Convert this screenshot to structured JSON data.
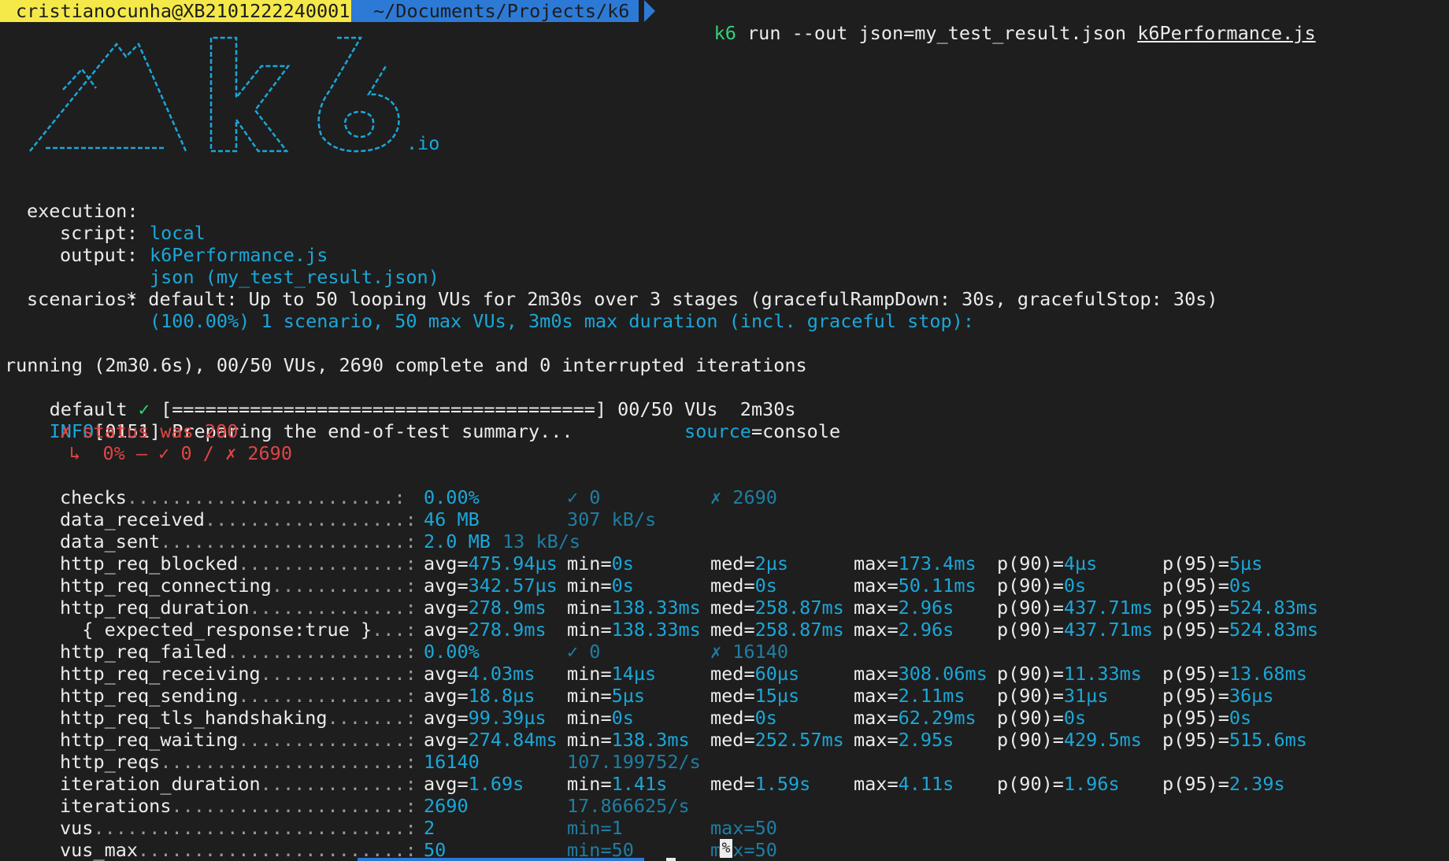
{
  "prompt": {
    "user": "cristianocunha@XB2101222240001",
    "path": "~/Documents/Projects/k6",
    "command": "k6",
    "args": " run --out json=my_test_result.json ",
    "script_file": "k6Performance.js"
  },
  "logo": {
    "suffix": ".io"
  },
  "execution": {
    "execution_label": "execution:",
    "execution_value": "local",
    "script_label": "script:",
    "script_value": "k6Performance.js",
    "output_label": "output:",
    "output_value": "json (my_test_result.json)"
  },
  "scenarios": {
    "label": "scenarios:",
    "value": "(100.00%) 1 scenario, 50 max VUs, 3m0s max duration (incl. graceful stop):",
    "detail": "* default: Up to 50 looping VUs for 2m30s over 3 stages (gracefulRampDown: 30s, gracefulStop: 30s)"
  },
  "progress": {
    "running": "running (2m30.6s), 00/50 VUs, 2690 complete and 0 interrupted iterations",
    "default_name": "default ",
    "default_check": "✓",
    "bar": " [======================================] 00/50 VUs  2m30s",
    "info_tag": "INFO",
    "info_text": "[0151] Preparing the end-of-test summary...          ",
    "source_key": "source",
    "source_value": "=console"
  },
  "check_result": {
    "line1": "✗ status was 200",
    "line2": "↳  0% — ✓ 0 / ✗ 2690"
  },
  "metrics": [
    {
      "name": "checks",
      "dots": "........................:",
      "v": [
        "0.00%",
        "✓ 0",
        "✗ 2690"
      ],
      "type": "rate"
    },
    {
      "name": "data_received",
      "dots": "..................:",
      "v": [
        "46 MB",
        "307 kB/s"
      ],
      "type": "counter"
    },
    {
      "name": "data_sent",
      "dots": "......................:",
      "v": [
        "2.0 MB",
        "13 kB/s"
      ],
      "type": "counter_tight"
    },
    {
      "name": "http_req_blocked",
      "dots": "...............:",
      "v": [
        "avg=475.94µs",
        "min=0s",
        "med=2µs",
        "max=173.4ms",
        "p(90)=4µs",
        "p(95)=5µs"
      ],
      "type": "trend"
    },
    {
      "name": "http_req_connecting",
      "dots": "............:",
      "v": [
        "avg=342.57µs",
        "min=0s",
        "med=0s",
        "max=50.11ms",
        "p(90)=0s",
        "p(95)=0s"
      ],
      "type": "trend"
    },
    {
      "name": "http_req_duration",
      "dots": "..............:",
      "v": [
        "avg=278.9ms",
        "min=138.33ms",
        "med=258.87ms",
        "max=2.96s",
        "p(90)=437.71ms",
        "p(95)=524.83ms"
      ],
      "type": "trend"
    },
    {
      "name": "  { expected_response:true }",
      "dots": "...:",
      "v": [
        "avg=278.9ms",
        "min=138.33ms",
        "med=258.87ms",
        "max=2.96s",
        "p(90)=437.71ms",
        "p(95)=524.83ms"
      ],
      "type": "trend"
    },
    {
      "name": "http_req_failed",
      "dots": "................:",
      "v": [
        "0.00%",
        "✓ 0",
        "✗ 16140"
      ],
      "type": "rate"
    },
    {
      "name": "http_req_receiving",
      "dots": ".............:",
      "v": [
        "avg=4.03ms",
        "min=14µs",
        "med=60µs",
        "max=308.06ms",
        "p(90)=11.33ms",
        "p(95)=13.68ms"
      ],
      "type": "trend"
    },
    {
      "name": "http_req_sending",
      "dots": "...............:",
      "v": [
        "avg=18.8µs",
        "min=5µs",
        "med=15µs",
        "max=2.11ms",
        "p(90)=31µs",
        "p(95)=36µs"
      ],
      "type": "trend"
    },
    {
      "name": "http_req_tls_handshaking",
      "dots": ".......:",
      "v": [
        "avg=99.39µs",
        "min=0s",
        "med=0s",
        "max=62.29ms",
        "p(90)=0s",
        "p(95)=0s"
      ],
      "type": "trend"
    },
    {
      "name": "http_req_waiting",
      "dots": "...............:",
      "v": [
        "avg=274.84ms",
        "min=138.3ms",
        "med=252.57ms",
        "max=2.95s",
        "p(90)=429.5ms",
        "p(95)=515.6ms"
      ],
      "type": "trend"
    },
    {
      "name": "http_reqs",
      "dots": "......................:",
      "v": [
        "16140",
        "107.199752/s"
      ],
      "type": "counter"
    },
    {
      "name": "iteration_duration",
      "dots": ".............:",
      "v": [
        "avg=1.69s",
        "min=1.41s",
        "med=1.59s",
        "max=4.11s",
        "p(90)=1.96s",
        "p(95)=2.39s"
      ],
      "type": "trend"
    },
    {
      "name": "iterations",
      "dots": ".....................:",
      "v": [
        "2690",
        "17.866625/s"
      ],
      "type": "counter"
    },
    {
      "name": "vus",
      "dots": "............................:",
      "v": [
        "2",
        "min=1",
        "max=50"
      ],
      "type": "gauge"
    },
    {
      "name": "vus_max",
      "dots": "........................:",
      "v": [
        "50",
        "min=50",
        "max=50"
      ],
      "type": "gauge"
    }
  ],
  "cursor": {
    "glyph": "%"
  }
}
